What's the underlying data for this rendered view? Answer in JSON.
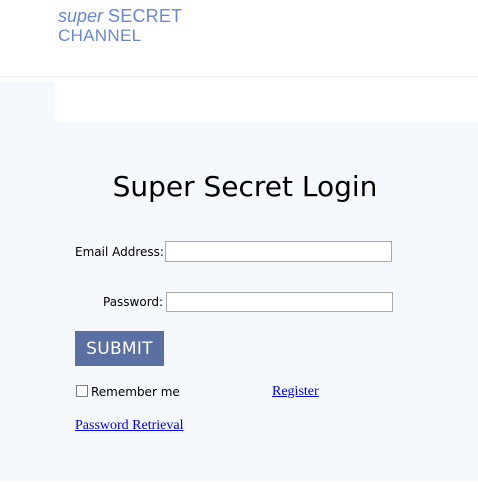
{
  "header": {
    "logo_super": "super",
    "logo_secret": "SECRET",
    "logo_channel": "CHANNEL",
    "logo_color": "#6a86d6"
  },
  "login": {
    "title": "Super Secret Login",
    "email_label": "Email Address:",
    "email_value": "",
    "password_label": "Password:",
    "password_value": "",
    "submit_label": "SUBMIT",
    "submit_color": "#5a6fa2",
    "remember_label": "Remember me",
    "remember_checked": false,
    "register_link": "Register",
    "password_retrieval_link": "Password Retrieval"
  }
}
